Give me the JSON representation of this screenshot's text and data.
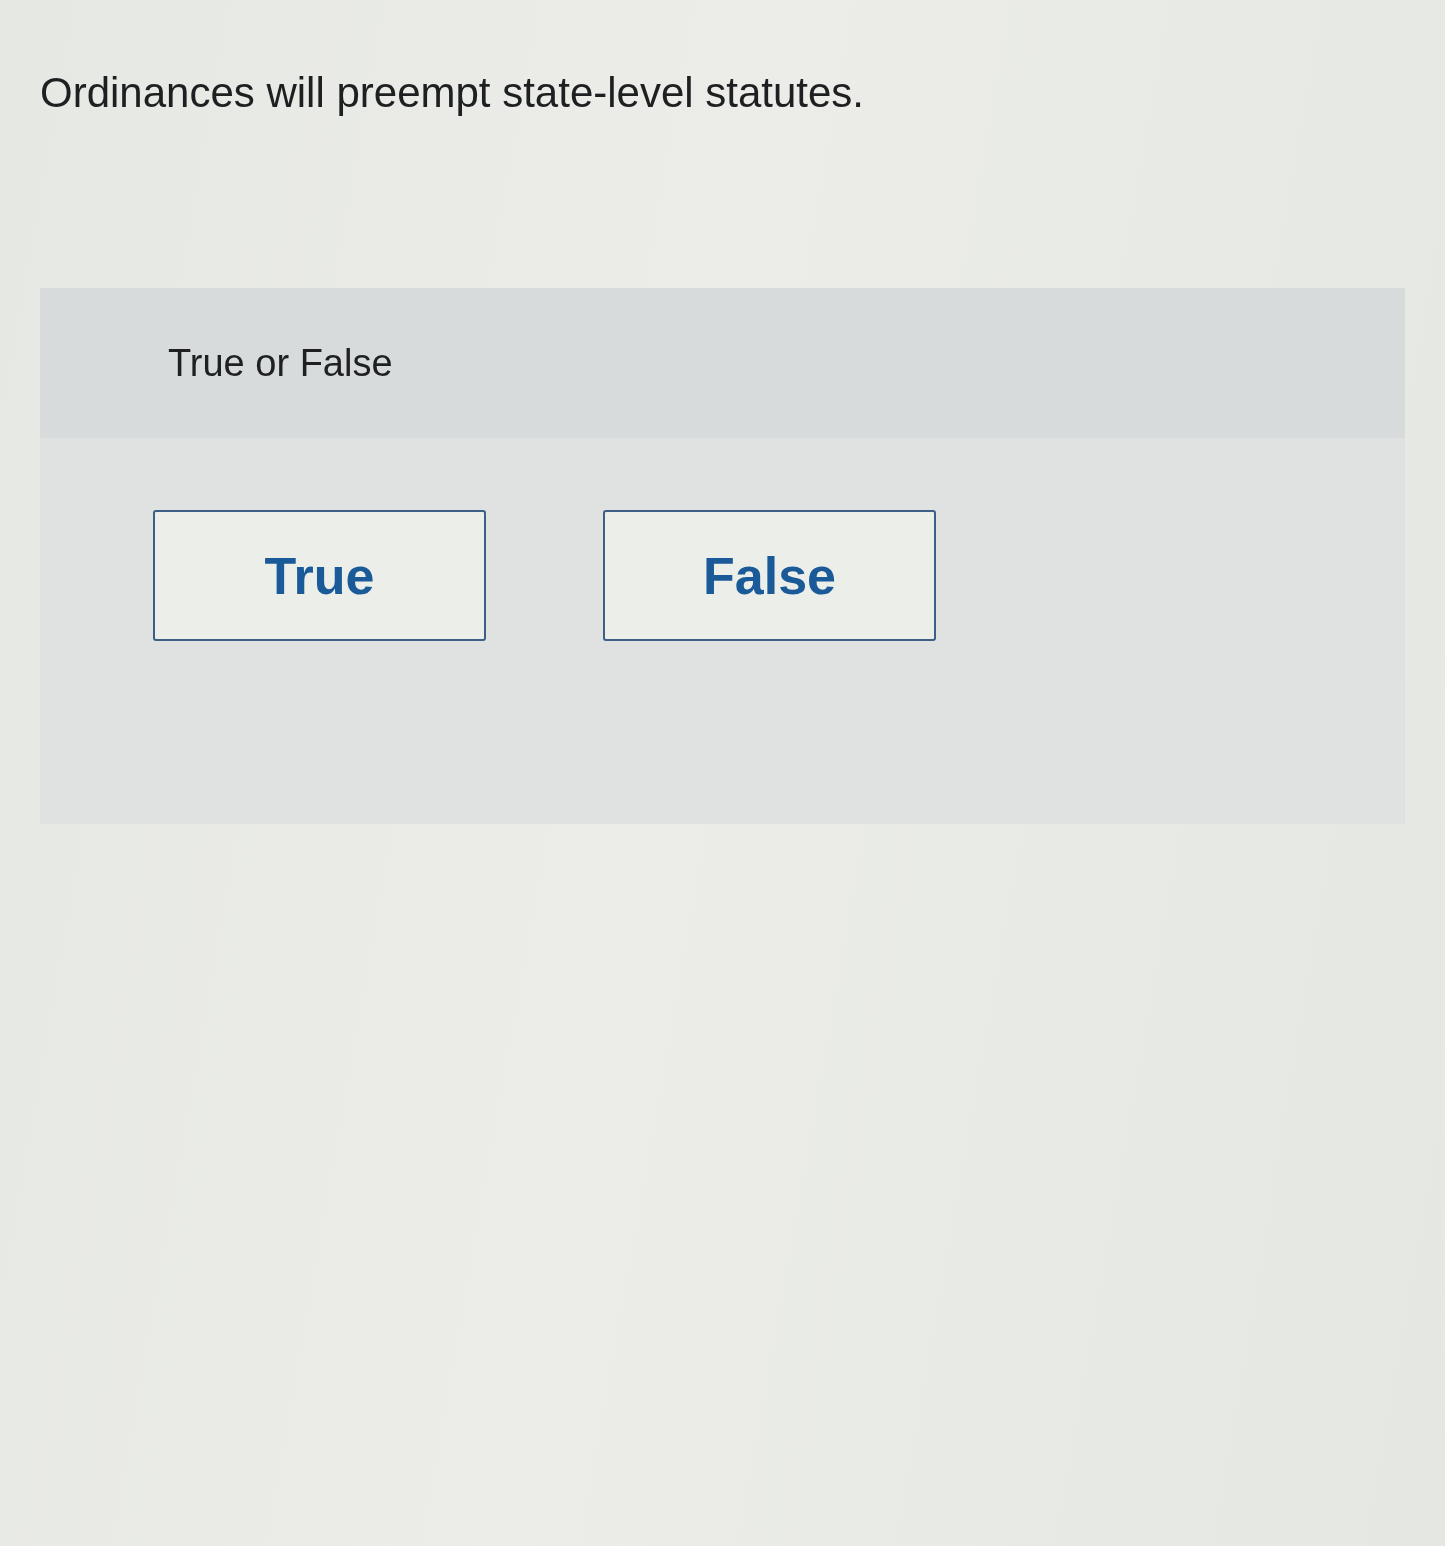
{
  "question": {
    "text": "Ordinances will preempt state-level statutes."
  },
  "answer_panel": {
    "label": "True or False",
    "options": [
      {
        "label": "True",
        "selected": false
      },
      {
        "label": "False",
        "selected": false
      }
    ]
  }
}
